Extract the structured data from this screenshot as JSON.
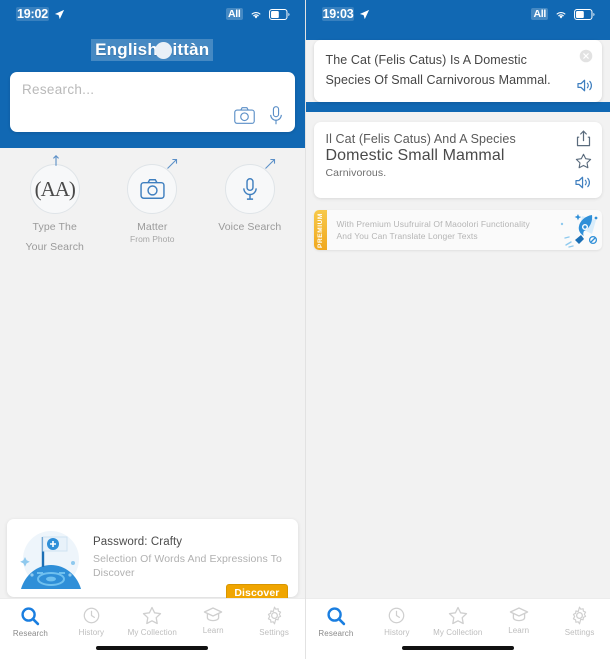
{
  "left": {
    "status": {
      "time": "19:02",
      "carrier": "All",
      "location_icon": "location-arrow-icon"
    },
    "header": {
      "language_pair": "English cittàn"
    },
    "search": {
      "placeholder": "Research...",
      "camera_icon": "camera-icon",
      "mic_icon": "microphone-icon"
    },
    "actions": [
      {
        "icon": "text-aa-icon",
        "glyph": "(AA)",
        "label": "Type The",
        "sub_label": "Your Search"
      },
      {
        "icon": "camera-icon",
        "glyph": "",
        "label": "Matter",
        "sub_label": "From Photo"
      },
      {
        "icon": "microphone-icon",
        "glyph": "",
        "label": "Voice Search",
        "sub_label": ""
      }
    ],
    "promo": {
      "title": "Password: Crafty",
      "description": "Selection Of Words And Expressions To Discover",
      "button_label": "Discover",
      "art_icon": "flag-hill-illustration"
    }
  },
  "right": {
    "status": {
      "time": "19:03",
      "carrier": "All",
      "location_icon": "location-arrow-icon"
    },
    "source_card": {
      "text": "The Cat (Felis Catus) Is A Domestic Species Of Small Carnivorous Mammal.",
      "clear_icon": "close-circle-icon",
      "speaker_icon": "speaker-icon"
    },
    "result_card": {
      "line1": "Il Cat (Felis Catus) And A Species",
      "line2": "Domestic Small Mammal",
      "line3": "Carnivorous.",
      "share_icon": "share-icon",
      "favorite_icon": "star-icon",
      "speaker_icon": "speaker-icon"
    },
    "premium": {
      "tag": "PREMIUM",
      "text": "With Premium Usufruiral Of Maoolori Functionality And You Can Translate Longer Texts",
      "art_icon": "rocket-illustration"
    }
  },
  "nav": {
    "items": [
      {
        "label": "Research",
        "icon": "search-icon",
        "active": true
      },
      {
        "label": "History",
        "icon": "history-clock-icon",
        "active": false
      },
      {
        "label": "My Collection",
        "icon": "star-icon",
        "active": false
      },
      {
        "label": "Learn",
        "icon": "graduation-cap-icon",
        "active": false
      },
      {
        "label": "Settings",
        "icon": "gear-icon",
        "active": false
      }
    ]
  },
  "colors": {
    "brand_blue": "#1168b3",
    "accent_gold": "#f0a500",
    "page_bg": "#f2f2f2"
  }
}
